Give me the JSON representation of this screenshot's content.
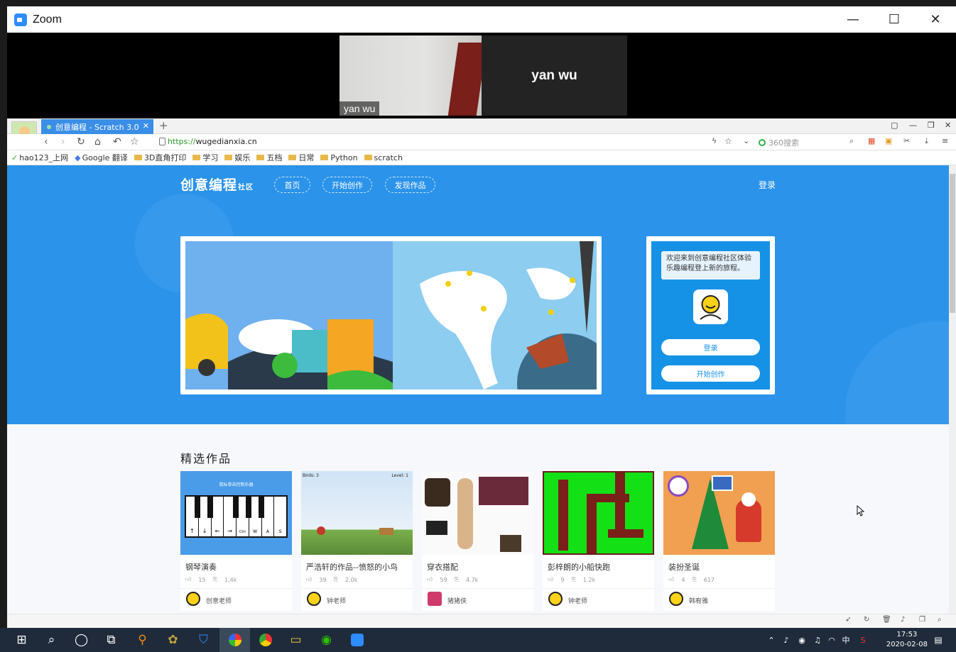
{
  "zoom": {
    "title": "Zoom",
    "participants": [
      {
        "name": "yan wu"
      },
      {
        "name": "yan wu"
      }
    ]
  },
  "browser": {
    "tab_title": "创意编程 - Scratch 3.0",
    "new_tab": "+",
    "url_scheme": "https://",
    "url_host": "wugedianxia.cn",
    "search_placeholder": "360搜索",
    "bookmarks": [
      {
        "label": "hao123_上网",
        "icon": "hao123-icon"
      },
      {
        "label": "Google 翻译",
        "icon": "google-translate-icon"
      },
      {
        "label": "3D直角打印",
        "icon": "folder-icon"
      },
      {
        "label": "学习",
        "icon": "folder-icon"
      },
      {
        "label": "娱乐",
        "icon": "folder-icon"
      },
      {
        "label": "五档",
        "icon": "folder-icon"
      },
      {
        "label": "日常",
        "icon": "folder-icon"
      },
      {
        "label": "Python",
        "icon": "folder-icon"
      },
      {
        "label": "scratch",
        "icon": "folder-icon"
      }
    ]
  },
  "site": {
    "logo": "创意编程",
    "logo_sub": "社区",
    "nav": [
      {
        "label": "首页"
      },
      {
        "label": "开始创作"
      },
      {
        "label": "发现作品"
      }
    ],
    "login_top": "登录",
    "welcome_message": "欢迎来到创意编程社区体验乐趣编程登上新的旅程。",
    "welcome_login": "登录",
    "welcome_create": "开始创作",
    "section_title": "精选作品",
    "cards": [
      {
        "title": "钢琴演奏",
        "likes": "15",
        "remixes": "1.4k",
        "author": "创意老师"
      },
      {
        "title": "严浩轩的作品--愤怒的小鸟",
        "likes": "39",
        "remixes": "2.0k",
        "author": "钟老师"
      },
      {
        "title": "穿衣搭配",
        "likes": "59",
        "remixes": "4.7k",
        "author": "猪猪侠"
      },
      {
        "title": "彭梓朗的小船快跑",
        "likes": "9",
        "remixes": "1.2k",
        "author": "钟老师"
      },
      {
        "title": "装扮圣诞",
        "likes": "4",
        "remixes": "617",
        "author": "韩宥雅"
      }
    ],
    "card_thumb_text": {
      "piano_caption": "鼠标单击控制乐器",
      "piano_keys": [
        "↑",
        "↓",
        "←",
        "→",
        "Ctrl",
        "W",
        "A",
        "S"
      ],
      "birds_count": "Birds: 3",
      "level": "Level: 1"
    }
  },
  "taskbar": {
    "time": "17:53",
    "date": "2020-02-08",
    "ime": "中"
  },
  "colors": {
    "hero_blue": "#2b93ea",
    "tab_blue": "#3a8ee6",
    "welcome_blue": "#1592e6"
  }
}
